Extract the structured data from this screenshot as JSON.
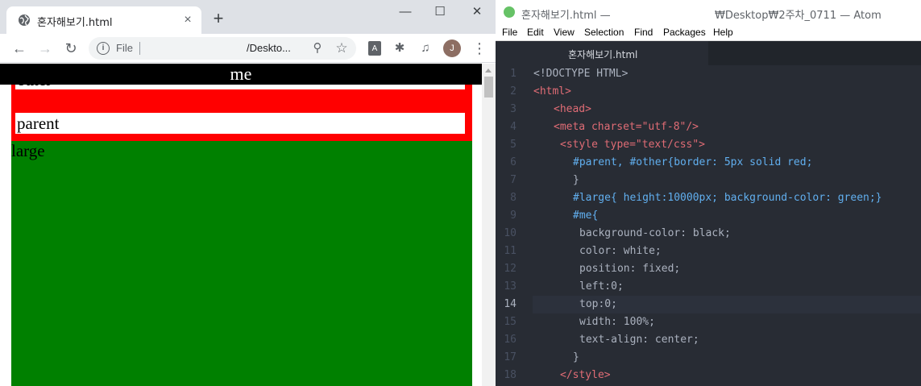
{
  "chrome": {
    "tab_title": "혼자해보기.html",
    "tab_close": "×",
    "new_tab": "+",
    "win_minimize": "—",
    "win_maximize": "☐",
    "win_close": "✕",
    "back": "←",
    "forward": "→",
    "reload": "↻",
    "omnibox": {
      "info": "i",
      "scheme": "File",
      "url": "/Deskto...",
      "zoom": "⚲",
      "star": "☆"
    },
    "extensions": {
      "pdf": "A",
      "puzzle": "✱",
      "media": "♫"
    },
    "avatar_letter": "J",
    "menu": "⋮"
  },
  "page": {
    "me_text": "me",
    "other_text": "other",
    "parent_text": "parent",
    "large_text": "large",
    "colors": {
      "me_bg": "#000000",
      "border": "#ff0000",
      "large_bg": "#008000"
    }
  },
  "atom": {
    "title": "혼자해보기.html —",
    "title_path": "₩Desktop₩2주차_0711 — Atom",
    "menu": [
      "File",
      "Edit",
      "View",
      "Selection",
      "Find",
      "Packages",
      "Help"
    ],
    "tab_label": "혼자해보기.html",
    "current_line": 14,
    "lines": [
      "<!DOCTYPE HTML>",
      "<html>",
      "<head>",
      "<meta charset=\"utf-8\"/>",
      "<style type=\"text/css\">",
      "#parent, #other{border: 5px solid red;",
      "}",
      "#large{ height:10000px; background-color: green;}",
      "#me{",
      "background-color: black;",
      "color: white;",
      "position: fixed;",
      "left:0;",
      "top:0;",
      "width: 100%;",
      "text-align: center;",
      "}",
      "</style>"
    ]
  }
}
